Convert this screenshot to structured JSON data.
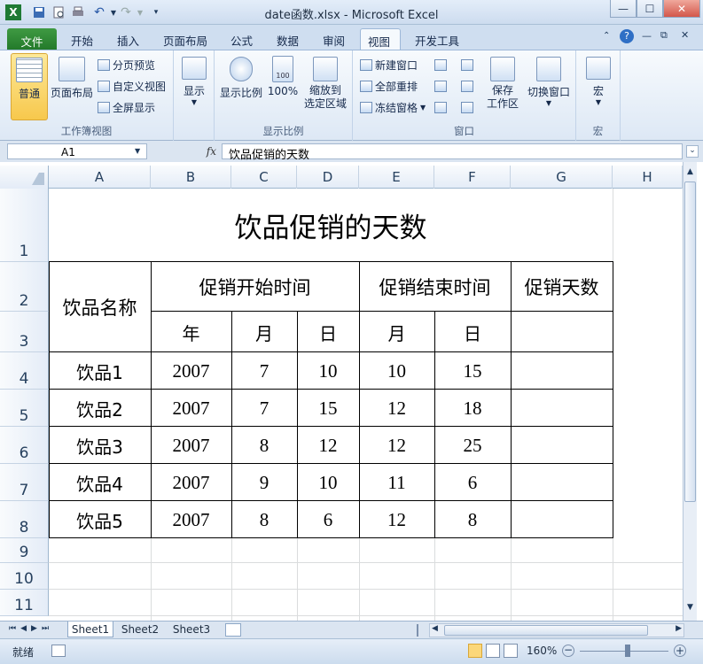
{
  "window": {
    "title": "date函数.xlsx - Microsoft Excel",
    "app_icon": "excel-icon"
  },
  "tabs": [
    "文件",
    "开始",
    "插入",
    "页面布局",
    "公式",
    "数据",
    "审阅",
    "视图",
    "开发工具"
  ],
  "active_tab": "视图",
  "ribbon": {
    "workbook_views": {
      "label": "工作簿视图",
      "normal": "普通",
      "page_layout": "页面布局",
      "page_break": "分页预览",
      "custom_views": "自定义视图",
      "full_screen": "全屏显示"
    },
    "show": {
      "label": "显示"
    },
    "zoom": {
      "label": "显示比例",
      "zoom_btn": "显示比例",
      "hundred": "100%",
      "zoom_sel_line1": "缩放到",
      "zoom_sel_line2": "选定区域"
    },
    "window": {
      "label": "窗口",
      "new_window": "新建窗口",
      "arrange_all": "全部重排",
      "freeze_panes": "冻结窗格",
      "save_ws_line1": "保存",
      "save_ws_line2": "工作区",
      "switch_windows": "切换窗口"
    },
    "macros": {
      "label": "宏",
      "macros_btn": "宏"
    }
  },
  "formula_bar": {
    "name_box": "A1",
    "fx": "fx",
    "formula": "饮品促销的天数"
  },
  "columns": [
    "A",
    "B",
    "C",
    "D",
    "E",
    "F",
    "G",
    "H"
  ],
  "rows": [
    "1",
    "2",
    "3",
    "4",
    "5",
    "6",
    "7",
    "8",
    "9",
    "10",
    "11"
  ],
  "spreadsheet": {
    "title": "饮品促销的天数",
    "header": {
      "name": "饮品名称",
      "start": "促销开始时间",
      "end": "促销结束时间",
      "days": "促销天数",
      "year": "年",
      "month_start": "月",
      "day_start": "日",
      "month_end": "月",
      "day_end": "日"
    },
    "data": [
      [
        "饮品1",
        "2007",
        "7",
        "10",
        "10",
        "15"
      ],
      [
        "饮品2",
        "2007",
        "7",
        "15",
        "12",
        "18"
      ],
      [
        "饮品3",
        "2007",
        "8",
        "12",
        "12",
        "25"
      ],
      [
        "饮品4",
        "2007",
        "9",
        "10",
        "11",
        "6"
      ],
      [
        "饮品5",
        "2007",
        "8",
        "6",
        "12",
        "8"
      ]
    ]
  },
  "sheets": [
    "Sheet1",
    "Sheet2",
    "Sheet3"
  ],
  "active_sheet": "Sheet1",
  "status": {
    "ready": "就绪",
    "zoom": "160%"
  }
}
